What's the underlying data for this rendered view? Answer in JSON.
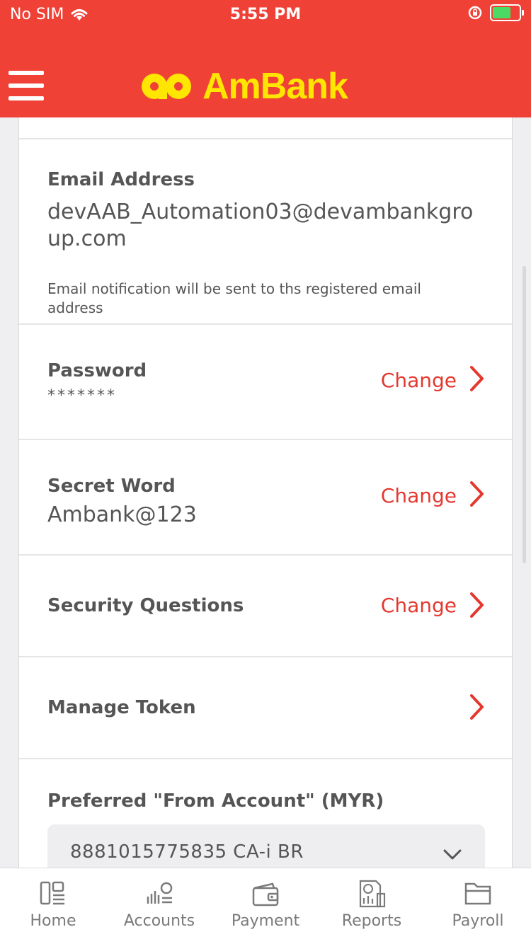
{
  "status_bar": {
    "carrier": "No SIM",
    "time": "5:55 PM"
  },
  "header": {
    "brand": "AmBank",
    "brand_color": "#ffe600",
    "background": "#ef4136"
  },
  "profile": {
    "email": {
      "label": "Email Address",
      "value": "devAAB_Automation03@devambankgroup.com",
      "note": "Email notification will be sent to ths registered email address"
    },
    "password": {
      "label": "Password",
      "value": "*******",
      "action": "Change"
    },
    "secret_word": {
      "label": "Secret Word",
      "value": "Ambank@123",
      "action": "Change"
    },
    "security_questions": {
      "label": "Security Questions",
      "action": "Change"
    },
    "manage_token": {
      "label": "Manage Token"
    },
    "preferred_account": {
      "label": "Preferred \"From Account\" (MYR)",
      "selected": "8881015775835 CA-i BR"
    }
  },
  "accent_color": "#e4382f",
  "tabbar": {
    "tabs": [
      {
        "label": "Home",
        "icon": "home-icon"
      },
      {
        "label": "Accounts",
        "icon": "accounts-icon"
      },
      {
        "label": "Payment",
        "icon": "wallet-icon"
      },
      {
        "label": "Reports",
        "icon": "reports-icon"
      },
      {
        "label": "Payroll",
        "icon": "folder-icon"
      }
    ]
  }
}
